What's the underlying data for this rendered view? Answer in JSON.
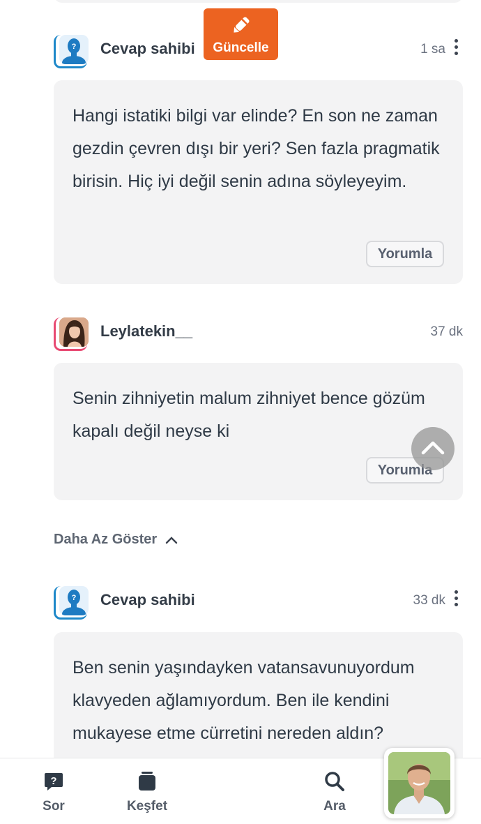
{
  "comments": [
    {
      "author": "Cevap sahibi",
      "time": "1 sa",
      "text": "Hangi istatiki bilgi var elinde? En son ne zaman gezdin çevren dışı bir yeri? Sen fazla pragmatik birisin. Hiç iyi değil senin adına söyleyeyim.",
      "reply_label": "Yorumla"
    },
    {
      "author": "Leylatekin__",
      "time": "37 dk",
      "text": "Senin zihniyetin malum zihniyet bence gözüm kapalı değil neyse ki",
      "reply_label": "Yorumla"
    },
    {
      "author": "Cevap sahibi",
      "time": "33 dk",
      "text": "Ben senin yaşındayken vatansavunuyordum klavyeden ağlamıyordum. Ben ile kendini mukayese etme cürretini nereden aldın?"
    }
  ],
  "show_less_label": "Daha Az Göster",
  "nav": {
    "ask": "Sor",
    "explore": "Keşfet",
    "update": "Güncelle",
    "search": "Ara"
  },
  "colors": {
    "accent": "#ec6321",
    "owner_ring": "#1e88c9",
    "user_ring": "#e84a72",
    "bubble_bg": "#f3f3f4"
  }
}
